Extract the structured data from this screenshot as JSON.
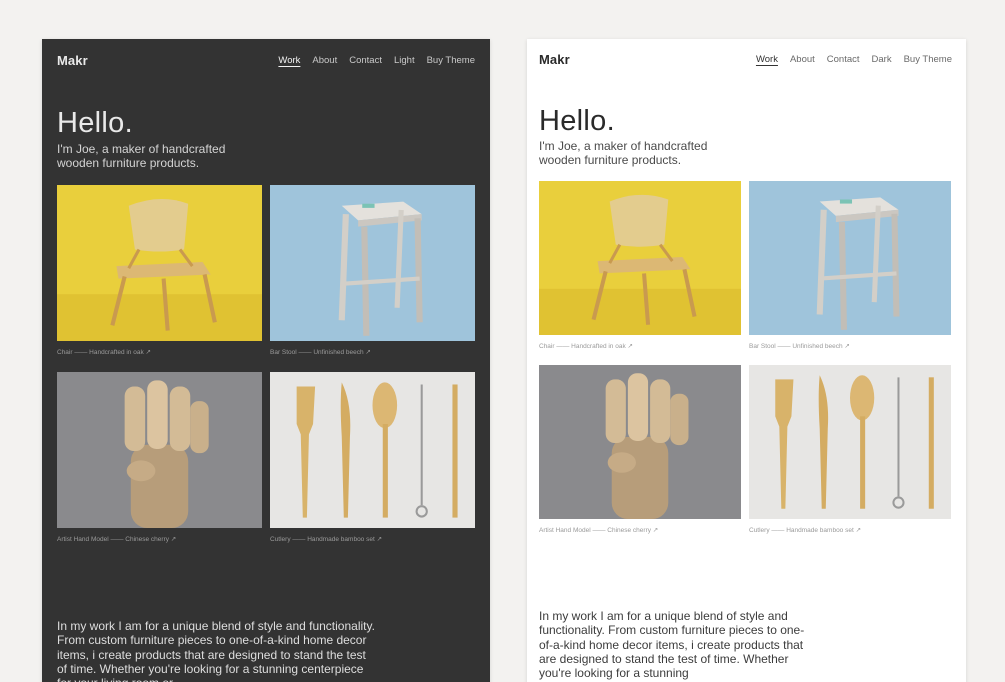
{
  "dark": {
    "logo": "Makr",
    "nav": [
      "Work",
      "About",
      "Contact",
      "Light",
      "Buy Theme"
    ],
    "hero_title": "Hello.",
    "hero_subtitle": "I'm Joe, a maker of handcrafted wooden furniture products.",
    "items": [
      {
        "caption": "Chair —— Handcrafted in oak  ↗"
      },
      {
        "caption": "Bar Stool —— Unfinished beech  ↗"
      },
      {
        "caption": "Artist Hand Model —— Chinese cherry  ↗"
      },
      {
        "caption": "Cutlery —— Handmade bamboo set  ↗"
      }
    ],
    "body": "In my work I am for a unique blend of style and functionality. From custom furniture pieces to one-of-a-kind home decor items, i create products that  are designed to stand the test of time. Whether you're looking for a stunning centerpiece for your living room or"
  },
  "light": {
    "logo": "Makr",
    "nav": [
      "Work",
      "About",
      "Contact",
      "Dark",
      "Buy Theme"
    ],
    "hero_title": "Hello.",
    "hero_subtitle": "I'm Joe, a maker of handcrafted wooden furniture products.",
    "items": [
      {
        "caption": "Chair —— Handcrafted in oak  ↗"
      },
      {
        "caption": "Bar Stool —— Unfinished beech  ↗"
      },
      {
        "caption": "Artist Hand Model —— Chinese cherry  ↗"
      },
      {
        "caption": "Cutlery —— Handmade bamboo set  ↗"
      }
    ],
    "body": "In my work I am for a unique blend of style and functionality. From custom furniture pieces to one-of-a-kind home decor items, i create products that  are designed to stand the test of time. Whether you're looking for a stunning"
  },
  "colors": {
    "chair_bg": "#e9cf3c",
    "stool_bg": "#9fc4db",
    "hand_bg": "#8a8a8d",
    "cutlery_bg": "#e7e6e4",
    "wood": "#d9b878"
  }
}
